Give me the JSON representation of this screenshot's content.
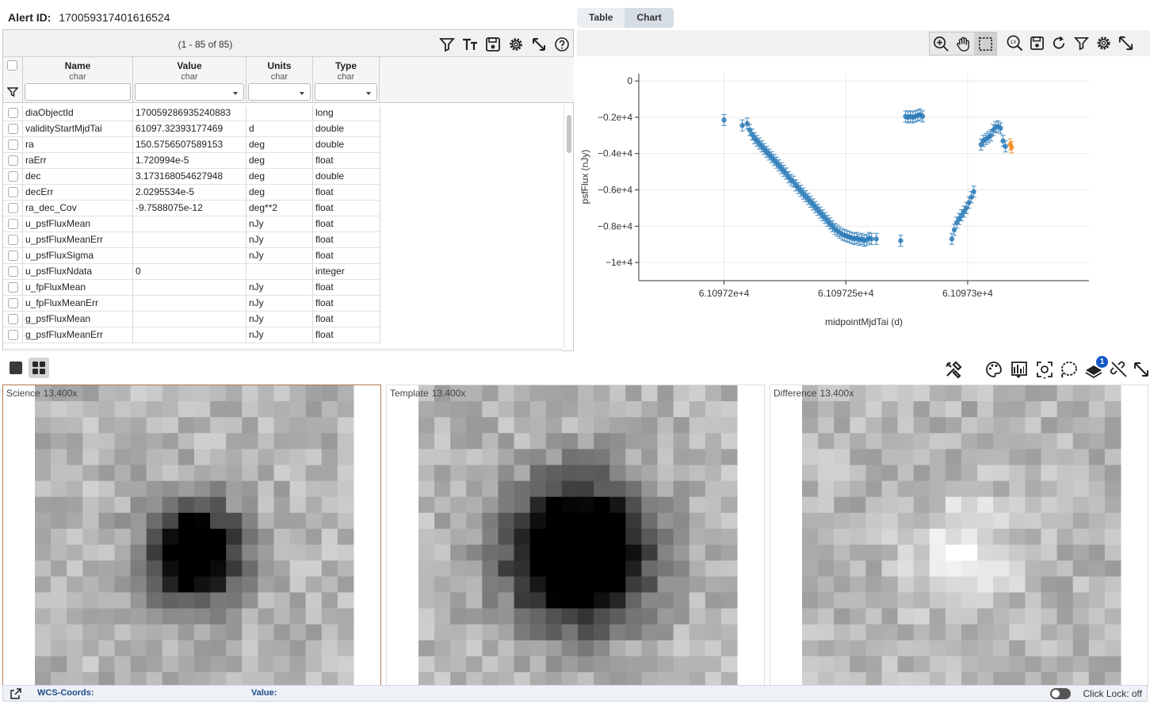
{
  "alert": {
    "label": "Alert ID:",
    "id": "170059317401616524"
  },
  "table": {
    "paging": "(1 - 85 of 85)",
    "columns": [
      {
        "name": "Name",
        "type": "char"
      },
      {
        "name": "Value",
        "type": "char"
      },
      {
        "name": "Units",
        "type": "char"
      },
      {
        "name": "Type",
        "type": "char"
      }
    ],
    "rows": [
      [
        "diaObjectId",
        "170059286935240883",
        "",
        "long"
      ],
      [
        "validityStartMjdTai",
        "61097.32393177469",
        "d",
        "double"
      ],
      [
        "ra",
        "150.5756507589153",
        "deg",
        "double"
      ],
      [
        "raErr",
        "1.720994e-5",
        "deg",
        "float"
      ],
      [
        "dec",
        "3.173168054627948",
        "deg",
        "double"
      ],
      [
        "decErr",
        "2.0295534e-5",
        "deg",
        "float"
      ],
      [
        "ra_dec_Cov",
        "-9.7588075e-12",
        "deg**2",
        "float"
      ],
      [
        "u_psfFluxMean",
        "",
        "nJy",
        "float"
      ],
      [
        "u_psfFluxMeanErr",
        "",
        "nJy",
        "float"
      ],
      [
        "u_psfFluxSigma",
        "",
        "nJy",
        "float"
      ],
      [
        "u_psfFluxNdata",
        "0",
        "",
        "integer"
      ],
      [
        "u_fpFluxMean",
        "",
        "nJy",
        "float"
      ],
      [
        "u_fpFluxMeanErr",
        "",
        "nJy",
        "float"
      ],
      [
        "g_psfFluxMean",
        "",
        "nJy",
        "float"
      ],
      [
        "g_psfFluxMeanErr",
        "",
        "nJy",
        "float"
      ]
    ]
  },
  "tabs": [
    {
      "label": "Table"
    },
    {
      "label": "Chart"
    }
  ],
  "chart_data": {
    "type": "scatter",
    "title": "",
    "xlabel": "midpointMjdTai (d)",
    "ylabel": "psfFlux (nJy)",
    "xlim": [
      61097.165,
      61097.3498
    ],
    "ylim": [
      -11000,
      400
    ],
    "xticks": [
      {
        "v": 61097.2,
        "label": "6.10972e+4"
      },
      {
        "v": 61097.25,
        "label": "6.109725e+4"
      },
      {
        "v": 61097.3,
        "label": "6.10973e+4"
      }
    ],
    "yticks": [
      {
        "v": 0,
        "label": "0"
      },
      {
        "v": -2000,
        "label": "−0.2e+4"
      },
      {
        "v": -4000,
        "label": "−0.4e+4"
      },
      {
        "v": -6000,
        "label": "−0.6e+4"
      },
      {
        "v": -8000,
        "label": "−0.8e+4"
      },
      {
        "v": -10000,
        "label": "−1e+4"
      }
    ],
    "grid": true,
    "series": [
      {
        "color": "#2b7bb9",
        "points": [
          [
            61097.2,
            -2150
          ],
          [
            61097.2075,
            -2450
          ],
          [
            61097.2095,
            -2350
          ],
          [
            61097.2105,
            -2700
          ],
          [
            61097.2115,
            -2950
          ],
          [
            61097.2125,
            -3150
          ],
          [
            61097.2135,
            -3300
          ],
          [
            61097.2145,
            -3450
          ],
          [
            61097.2155,
            -3600
          ],
          [
            61097.2165,
            -3750
          ],
          [
            61097.2175,
            -3900
          ],
          [
            61097.2185,
            -4050
          ],
          [
            61097.2195,
            -4200
          ],
          [
            61097.2205,
            -4350
          ],
          [
            61097.2215,
            -4500
          ],
          [
            61097.2225,
            -4650
          ],
          [
            61097.2235,
            -4800
          ],
          [
            61097.2245,
            -4950
          ],
          [
            61097.2255,
            -5100
          ],
          [
            61097.2265,
            -5300
          ],
          [
            61097.2275,
            -5450
          ],
          [
            61097.2285,
            -5550
          ],
          [
            61097.2295,
            -5750
          ],
          [
            61097.2305,
            -5900
          ],
          [
            61097.2315,
            -6050
          ],
          [
            61097.2325,
            -6200
          ],
          [
            61097.2335,
            -6350
          ],
          [
            61097.2345,
            -6500
          ],
          [
            61097.2355,
            -6650
          ],
          [
            61097.2365,
            -6800
          ],
          [
            61097.2375,
            -6950
          ],
          [
            61097.2385,
            -7100
          ],
          [
            61097.2395,
            -7250
          ],
          [
            61097.2405,
            -7400
          ],
          [
            61097.2415,
            -7550
          ],
          [
            61097.2425,
            -7700
          ],
          [
            61097.2435,
            -7850
          ],
          [
            61097.2445,
            -8000
          ],
          [
            61097.2455,
            -8150
          ],
          [
            61097.2465,
            -8250
          ],
          [
            61097.2475,
            -8350
          ],
          [
            61097.2485,
            -8450
          ],
          [
            61097.2495,
            -8500
          ],
          [
            61097.2505,
            -8550
          ],
          [
            61097.2515,
            -8600
          ],
          [
            61097.2525,
            -8650
          ],
          [
            61097.2535,
            -8700
          ],
          [
            61097.2545,
            -8650
          ],
          [
            61097.2555,
            -8750
          ],
          [
            61097.2565,
            -8700
          ],
          [
            61097.2575,
            -8800
          ],
          [
            61097.2585,
            -8750
          ],
          [
            61097.2595,
            -8650
          ],
          [
            61097.2605,
            -8700
          ],
          [
            61097.2625,
            -8700
          ],
          [
            61097.2745,
            -1950
          ],
          [
            61097.2755,
            -2000
          ],
          [
            61097.2765,
            -1950
          ],
          [
            61097.2775,
            -2000
          ],
          [
            61097.2785,
            -1950
          ],
          [
            61097.2795,
            -1900
          ],
          [
            61097.2805,
            -1850
          ],
          [
            61097.2815,
            -1950
          ],
          [
            61097.2725,
            -8800
          ],
          [
            61097.2935,
            -8700
          ],
          [
            61097.2945,
            -8200
          ],
          [
            61097.2955,
            -7800
          ],
          [
            61097.2965,
            -7600
          ],
          [
            61097.2975,
            -7400
          ],
          [
            61097.2985,
            -7200
          ],
          [
            61097.2995,
            -7000
          ],
          [
            61097.3005,
            -6700
          ],
          [
            61097.3015,
            -6400
          ],
          [
            61097.3025,
            -6100
          ],
          [
            61097.3055,
            -3500
          ],
          [
            61097.3065,
            -3300
          ],
          [
            61097.3075,
            -3200
          ],
          [
            61097.3085,
            -3100
          ],
          [
            61097.3095,
            -3000
          ],
          [
            61097.3105,
            -2700
          ],
          [
            61097.3115,
            -2550
          ],
          [
            61097.3125,
            -2500
          ],
          [
            61097.3135,
            -2600
          ],
          [
            61097.3145,
            -3300
          ],
          [
            61097.3155,
            -3600
          ]
        ]
      },
      {
        "color": "#f08b21",
        "points": [
          [
            61097.3175,
            -3500
          ],
          [
            61097.318,
            -3650
          ]
        ]
      }
    ]
  },
  "images": {
    "layout_icons": [
      "single-view-icon",
      "grid-view-icon"
    ],
    "panels": [
      {
        "title": "Science",
        "zoom": "13.400x"
      },
      {
        "title": "Template",
        "zoom": "13.400x"
      },
      {
        "title": "Difference",
        "zoom": "13.400x"
      }
    ]
  },
  "status": {
    "wcs": "WCS-Coords:",
    "value": "Value:",
    "lock": "Click Lock: off"
  },
  "layer_badge": "1"
}
